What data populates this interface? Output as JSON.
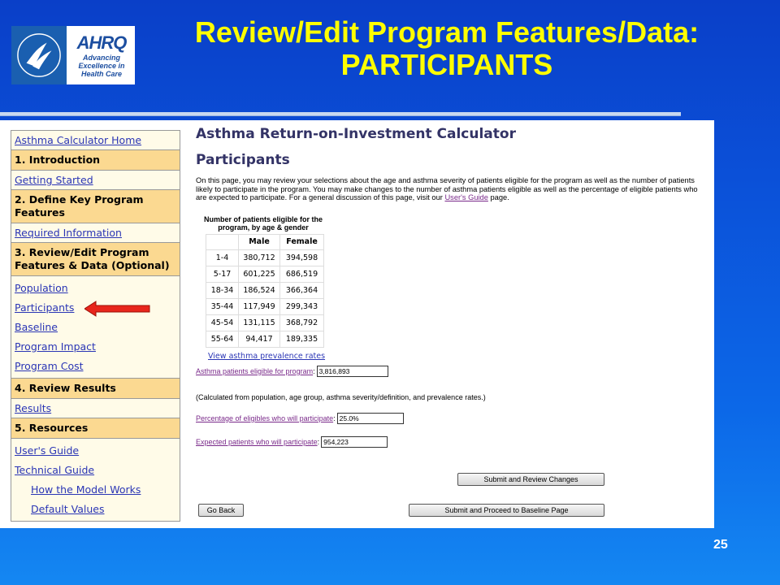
{
  "slide": {
    "title_line1": "Review/Edit Program Features/Data:",
    "title_line2": "PARTICIPANTS",
    "page_number": "25"
  },
  "logos": {
    "ahrq_mark": "AHRQ",
    "ahrq_tagline": [
      "Advancing",
      "Excellence in",
      "Health Care"
    ]
  },
  "sidebar": {
    "home": "Asthma Calculator Home",
    "sec1": "1. Introduction",
    "getting_started": "Getting Started",
    "sec2": "2. Define Key Program Features",
    "required_info": "Required Information",
    "sec3": "3. Review/Edit Program Features & Data (Optional)",
    "sec3_items": [
      "Population",
      "Participants",
      "Baseline",
      "Program Impact",
      "Program Cost"
    ],
    "sec4": "4. Review Results",
    "results": "Results",
    "sec5": "5. Resources",
    "sec5_items": [
      "User's Guide",
      "Technical Guide",
      "How the Model Works",
      "Default Values"
    ]
  },
  "main": {
    "calc_title": "Asthma Return-on-Investment Calculator",
    "page_title": "Participants",
    "intro": "On this page, you may review your selections about the age and asthma severity of patients eligible for the program as well as the number of patients likely to participate in the program. You may make changes to the number of asthma patients eligible as well as the percentage of eligible patients who are expected to participate. For a general discussion of this page, visit our ",
    "intro_link": "User's Guide",
    "intro_end": " page.",
    "table": {
      "caption": "Number of patients eligible for the program, by age & gender",
      "headers": [
        "",
        "Male",
        "Female"
      ],
      "rows": [
        [
          "1-4",
          "380,712",
          "394,598"
        ],
        [
          "5-17",
          "601,225",
          "686,519"
        ],
        [
          "18-34",
          "186,524",
          "366,364"
        ],
        [
          "35-44",
          "117,949",
          "299,343"
        ],
        [
          "45-54",
          "131,115",
          "368,792"
        ],
        [
          "55-64",
          "94,417",
          "189,335"
        ]
      ]
    },
    "prevalence_link": "View asthma prevalence rates",
    "eligible_label": "Asthma patients eligible for program",
    "eligible_value": "3,816,893",
    "note": "(Calculated from population, age group, asthma severity/definition, and prevalence rates.)",
    "pct_label": "Percentage of eligibles who will participate",
    "pct_value": "25.0%",
    "expected_label": "Expected patients who will participate",
    "expected_value": "954,223",
    "btn_submit_review": "Submit and Review Changes",
    "btn_go_back": "Go Back",
    "btn_submit_proceed": "Submit and Proceed to Baseline Page"
  },
  "colors": {
    "title_yellow": "#ffff00",
    "nav_header": "#fbd991",
    "nav_bg": "#fffbe8",
    "link_blue": "#2a35b5",
    "arrow_red": "#e8261c"
  }
}
